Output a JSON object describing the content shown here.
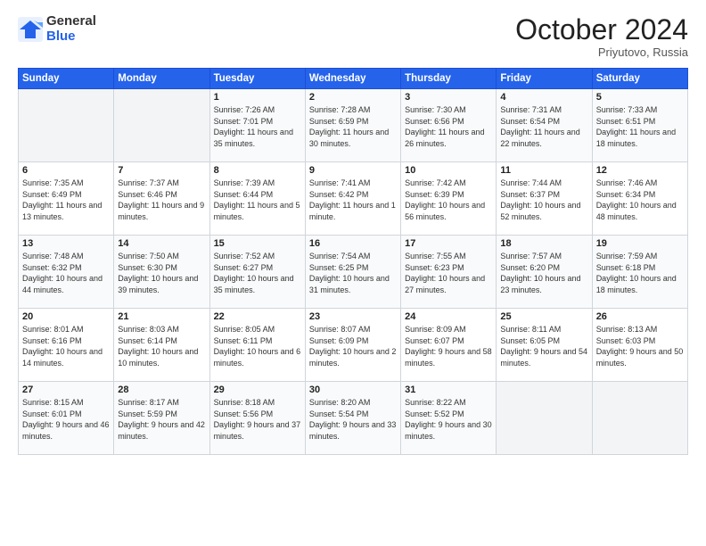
{
  "logo": {
    "general": "General",
    "blue": "Blue"
  },
  "title": "October 2024",
  "location": "Priyutovo, Russia",
  "days_of_week": [
    "Sunday",
    "Monday",
    "Tuesday",
    "Wednesday",
    "Thursday",
    "Friday",
    "Saturday"
  ],
  "weeks": [
    [
      {
        "day": "",
        "sunrise": "",
        "sunset": "",
        "daylight": ""
      },
      {
        "day": "",
        "sunrise": "",
        "sunset": "",
        "daylight": ""
      },
      {
        "day": "1",
        "sunrise": "Sunrise: 7:26 AM",
        "sunset": "Sunset: 7:01 PM",
        "daylight": "Daylight: 11 hours and 35 minutes."
      },
      {
        "day": "2",
        "sunrise": "Sunrise: 7:28 AM",
        "sunset": "Sunset: 6:59 PM",
        "daylight": "Daylight: 11 hours and 30 minutes."
      },
      {
        "day": "3",
        "sunrise": "Sunrise: 7:30 AM",
        "sunset": "Sunset: 6:56 PM",
        "daylight": "Daylight: 11 hours and 26 minutes."
      },
      {
        "day": "4",
        "sunrise": "Sunrise: 7:31 AM",
        "sunset": "Sunset: 6:54 PM",
        "daylight": "Daylight: 11 hours and 22 minutes."
      },
      {
        "day": "5",
        "sunrise": "Sunrise: 7:33 AM",
        "sunset": "Sunset: 6:51 PM",
        "daylight": "Daylight: 11 hours and 18 minutes."
      }
    ],
    [
      {
        "day": "6",
        "sunrise": "Sunrise: 7:35 AM",
        "sunset": "Sunset: 6:49 PM",
        "daylight": "Daylight: 11 hours and 13 minutes."
      },
      {
        "day": "7",
        "sunrise": "Sunrise: 7:37 AM",
        "sunset": "Sunset: 6:46 PM",
        "daylight": "Daylight: 11 hours and 9 minutes."
      },
      {
        "day": "8",
        "sunrise": "Sunrise: 7:39 AM",
        "sunset": "Sunset: 6:44 PM",
        "daylight": "Daylight: 11 hours and 5 minutes."
      },
      {
        "day": "9",
        "sunrise": "Sunrise: 7:41 AM",
        "sunset": "Sunset: 6:42 PM",
        "daylight": "Daylight: 11 hours and 1 minute."
      },
      {
        "day": "10",
        "sunrise": "Sunrise: 7:42 AM",
        "sunset": "Sunset: 6:39 PM",
        "daylight": "Daylight: 10 hours and 56 minutes."
      },
      {
        "day": "11",
        "sunrise": "Sunrise: 7:44 AM",
        "sunset": "Sunset: 6:37 PM",
        "daylight": "Daylight: 10 hours and 52 minutes."
      },
      {
        "day": "12",
        "sunrise": "Sunrise: 7:46 AM",
        "sunset": "Sunset: 6:34 PM",
        "daylight": "Daylight: 10 hours and 48 minutes."
      }
    ],
    [
      {
        "day": "13",
        "sunrise": "Sunrise: 7:48 AM",
        "sunset": "Sunset: 6:32 PM",
        "daylight": "Daylight: 10 hours and 44 minutes."
      },
      {
        "day": "14",
        "sunrise": "Sunrise: 7:50 AM",
        "sunset": "Sunset: 6:30 PM",
        "daylight": "Daylight: 10 hours and 39 minutes."
      },
      {
        "day": "15",
        "sunrise": "Sunrise: 7:52 AM",
        "sunset": "Sunset: 6:27 PM",
        "daylight": "Daylight: 10 hours and 35 minutes."
      },
      {
        "day": "16",
        "sunrise": "Sunrise: 7:54 AM",
        "sunset": "Sunset: 6:25 PM",
        "daylight": "Daylight: 10 hours and 31 minutes."
      },
      {
        "day": "17",
        "sunrise": "Sunrise: 7:55 AM",
        "sunset": "Sunset: 6:23 PM",
        "daylight": "Daylight: 10 hours and 27 minutes."
      },
      {
        "day": "18",
        "sunrise": "Sunrise: 7:57 AM",
        "sunset": "Sunset: 6:20 PM",
        "daylight": "Daylight: 10 hours and 23 minutes."
      },
      {
        "day": "19",
        "sunrise": "Sunrise: 7:59 AM",
        "sunset": "Sunset: 6:18 PM",
        "daylight": "Daylight: 10 hours and 18 minutes."
      }
    ],
    [
      {
        "day": "20",
        "sunrise": "Sunrise: 8:01 AM",
        "sunset": "Sunset: 6:16 PM",
        "daylight": "Daylight: 10 hours and 14 minutes."
      },
      {
        "day": "21",
        "sunrise": "Sunrise: 8:03 AM",
        "sunset": "Sunset: 6:14 PM",
        "daylight": "Daylight: 10 hours and 10 minutes."
      },
      {
        "day": "22",
        "sunrise": "Sunrise: 8:05 AM",
        "sunset": "Sunset: 6:11 PM",
        "daylight": "Daylight: 10 hours and 6 minutes."
      },
      {
        "day": "23",
        "sunrise": "Sunrise: 8:07 AM",
        "sunset": "Sunset: 6:09 PM",
        "daylight": "Daylight: 10 hours and 2 minutes."
      },
      {
        "day": "24",
        "sunrise": "Sunrise: 8:09 AM",
        "sunset": "Sunset: 6:07 PM",
        "daylight": "Daylight: 9 hours and 58 minutes."
      },
      {
        "day": "25",
        "sunrise": "Sunrise: 8:11 AM",
        "sunset": "Sunset: 6:05 PM",
        "daylight": "Daylight: 9 hours and 54 minutes."
      },
      {
        "day": "26",
        "sunrise": "Sunrise: 8:13 AM",
        "sunset": "Sunset: 6:03 PM",
        "daylight": "Daylight: 9 hours and 50 minutes."
      }
    ],
    [
      {
        "day": "27",
        "sunrise": "Sunrise: 8:15 AM",
        "sunset": "Sunset: 6:01 PM",
        "daylight": "Daylight: 9 hours and 46 minutes."
      },
      {
        "day": "28",
        "sunrise": "Sunrise: 8:17 AM",
        "sunset": "Sunset: 5:59 PM",
        "daylight": "Daylight: 9 hours and 42 minutes."
      },
      {
        "day": "29",
        "sunrise": "Sunrise: 8:18 AM",
        "sunset": "Sunset: 5:56 PM",
        "daylight": "Daylight: 9 hours and 37 minutes."
      },
      {
        "day": "30",
        "sunrise": "Sunrise: 8:20 AM",
        "sunset": "Sunset: 5:54 PM",
        "daylight": "Daylight: 9 hours and 33 minutes."
      },
      {
        "day": "31",
        "sunrise": "Sunrise: 8:22 AM",
        "sunset": "Sunset: 5:52 PM",
        "daylight": "Daylight: 9 hours and 30 minutes."
      },
      {
        "day": "",
        "sunrise": "",
        "sunset": "",
        "daylight": ""
      },
      {
        "day": "",
        "sunrise": "",
        "sunset": "",
        "daylight": ""
      }
    ]
  ]
}
